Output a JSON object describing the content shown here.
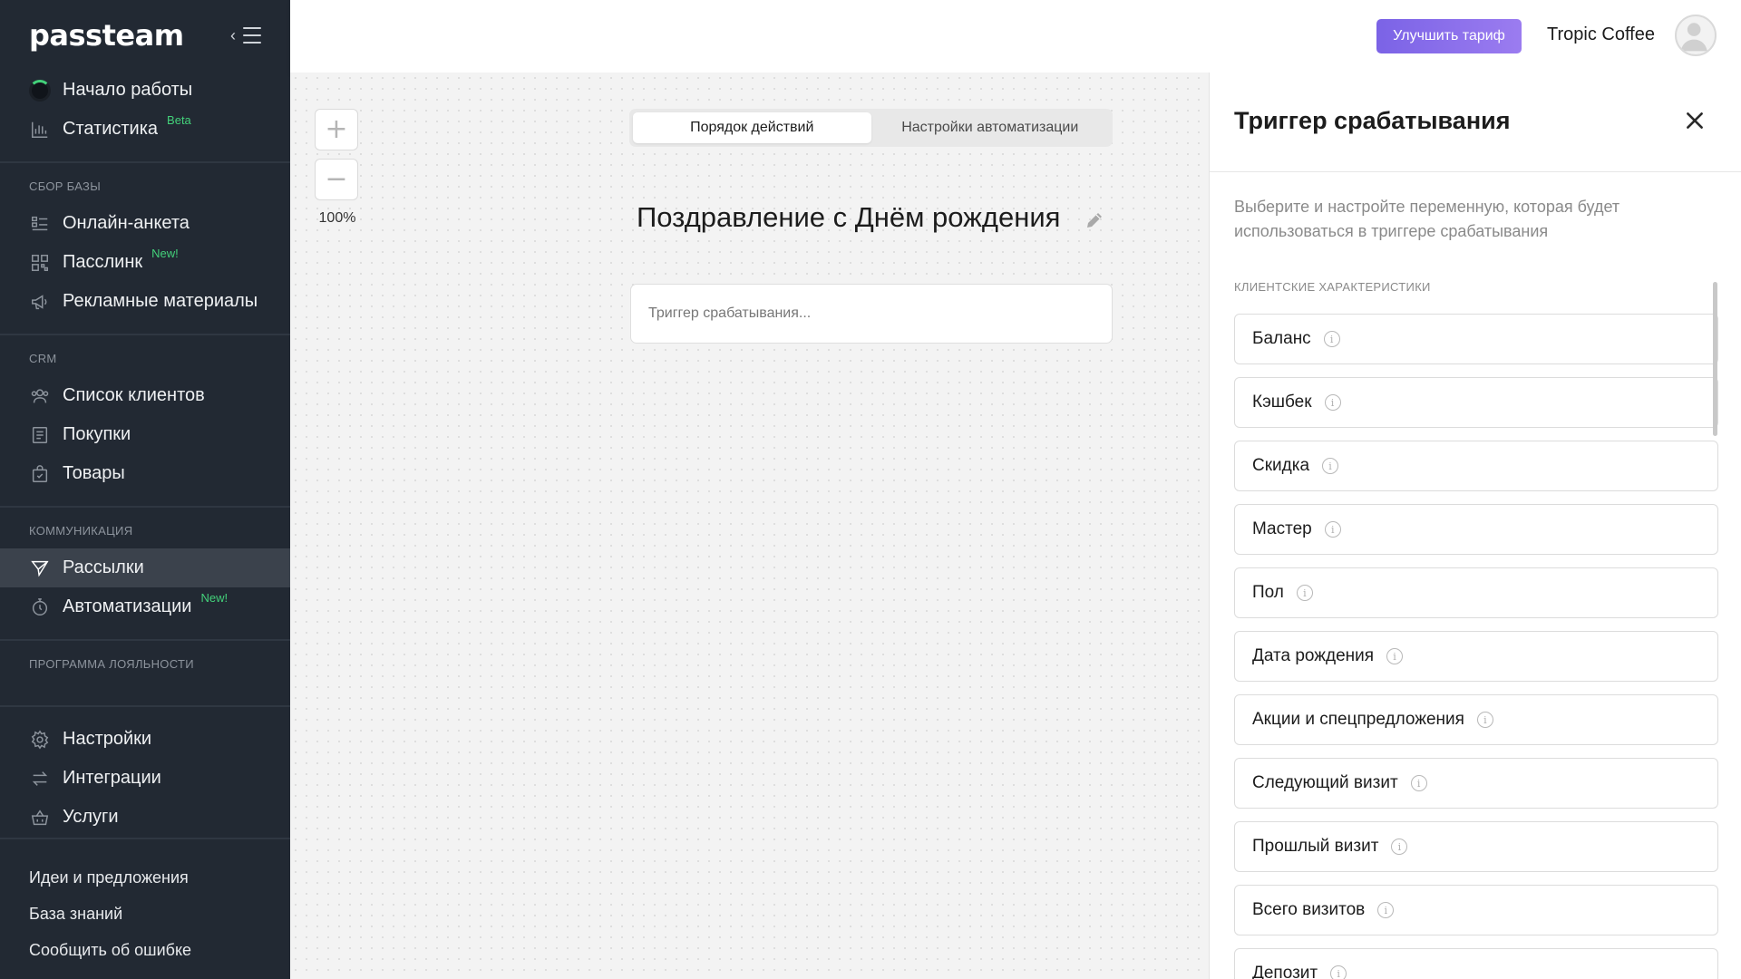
{
  "sidebar": {
    "logo": "passteam",
    "top_items": [
      {
        "label": "Начало работы",
        "icon": "loading-spinner-icon"
      },
      {
        "label": "Статистика",
        "badge": "Beta",
        "icon": "bar-chart-icon"
      }
    ],
    "sections": [
      {
        "title": "Сбор базы",
        "items": [
          {
            "label": "Онлайн-анкета",
            "icon": "form-icon"
          },
          {
            "label": "Пасслинк",
            "badge": "New!",
            "icon": "qr-code-icon"
          },
          {
            "label": "Рекламные материалы",
            "icon": "megaphone-icon"
          }
        ]
      },
      {
        "title": "CRM",
        "items": [
          {
            "label": "Список клиентов",
            "icon": "users-icon"
          },
          {
            "label": "Покупки",
            "icon": "receipt-icon"
          },
          {
            "label": "Товары",
            "icon": "shopping-bag-icon"
          }
        ]
      },
      {
        "title": "Коммуникация",
        "items": [
          {
            "label": "Рассылки",
            "icon": "paper-plane-icon",
            "active": true
          },
          {
            "label": "Автоматизации",
            "badge": "New!",
            "icon": "stopwatch-icon"
          }
        ]
      },
      {
        "title": "Программа лояльности",
        "items": []
      }
    ],
    "settings_items": [
      {
        "label": "Настройки",
        "icon": "gear-icon"
      },
      {
        "label": "Интеграции",
        "icon": "swap-arrows-icon"
      },
      {
        "label": "Услуги",
        "icon": "basket-icon"
      }
    ],
    "bottom_links": [
      "Идеи и предложения",
      "База знаний",
      "Сообщить об ошибке"
    ]
  },
  "header": {
    "upgrade_label": "Улучшить тариф",
    "company_name": "Tropic Coffee",
    "accent_color": "#8a6fed"
  },
  "canvas": {
    "zoom_in": "+",
    "zoom_out": "−",
    "zoom_level": "100%",
    "tabs": [
      {
        "label": "Порядок действий",
        "active": true
      },
      {
        "label": "Настройки автоматизации",
        "active": false
      }
    ],
    "title": "Поздравление с Днём рождения",
    "trigger_placeholder": "Триггер срабатывания..."
  },
  "panel": {
    "title": "Триггер срабатывания",
    "description": "Выберите и настройте переменную, которая будет использоваться в триггере срабатывания",
    "section_title": "Клиентские характеристики",
    "variables": [
      "Баланс",
      "Кэшбек",
      "Скидка",
      "Мастер",
      "Пол",
      "Дата рождения",
      "Акции и спецпредложения",
      "Следующий визит",
      "Прошлый визит",
      "Всего визитов",
      "Депозит"
    ]
  }
}
